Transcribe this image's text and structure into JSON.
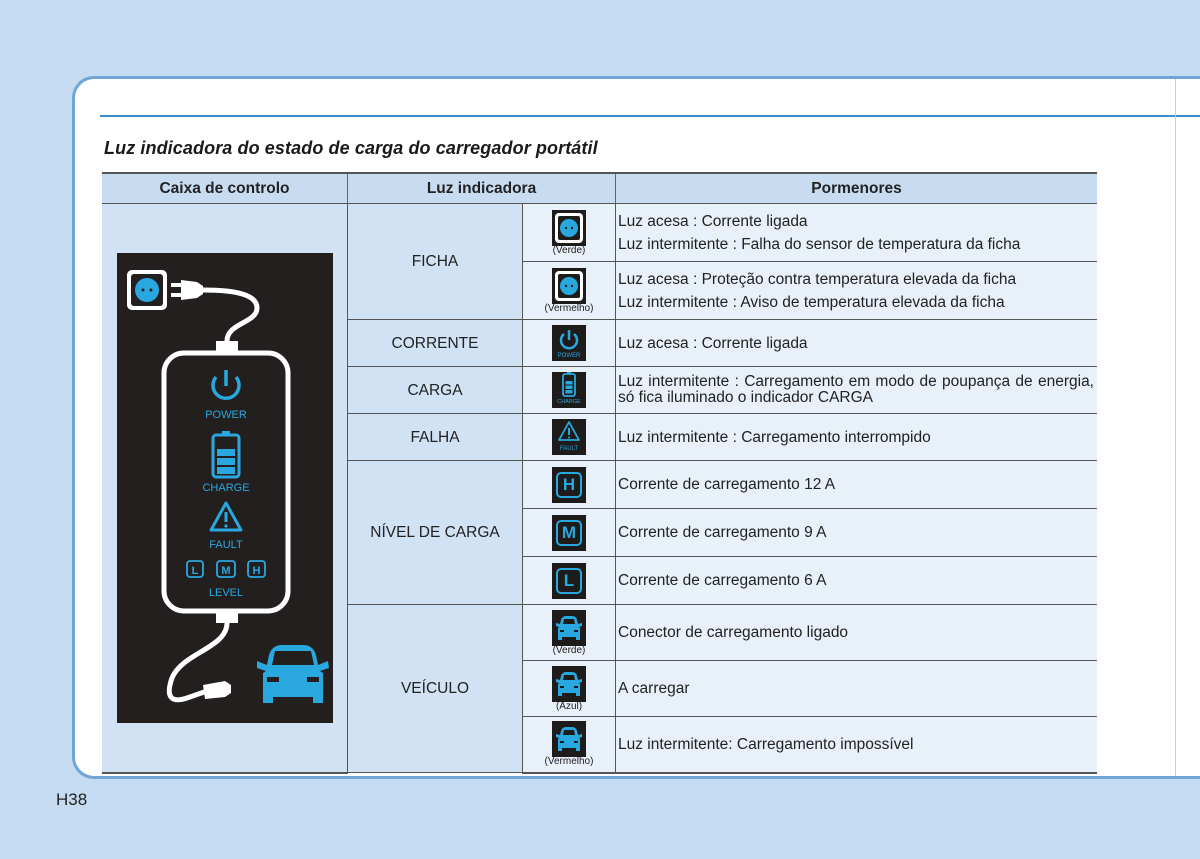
{
  "page": {
    "title": "Luz indicadora do estado de carga do carregador portátil",
    "page_number": "H38"
  },
  "colors": {
    "accent_blue": "#29a8e0",
    "panel_dark": "#231f1f",
    "header_bg": "#c8dcf1",
    "page_bg": "#c5dbf1"
  },
  "table": {
    "headers": [
      "Caixa de controlo",
      "Luz indicadora",
      "Pormenores"
    ],
    "control_box": {
      "labels": {
        "power": "POWER",
        "charge": "CHARGE",
        "fault": "FAULT",
        "level": "LEVEL",
        "level_l": "L",
        "level_m": "M",
        "level_h": "H"
      }
    },
    "groups": [
      {
        "name": "FICHA",
        "rows": [
          {
            "icon": "plug-socket-icon",
            "caption": "(Verde)",
            "details": [
              "Luz acesa : Corrente ligada",
              "Luz intermitente : Falha do sensor de temperatura da ficha"
            ]
          },
          {
            "icon": "plug-socket-icon",
            "caption": "(Vermelho)",
            "details": [
              "Luz acesa : Proteção contra temperatura elevada da ficha",
              "Luz intermitente : Aviso de temperatura elevada da ficha"
            ]
          }
        ]
      },
      {
        "name": "CORRENTE",
        "rows": [
          {
            "icon": "power-icon",
            "icon_label": "POWER",
            "details": [
              "Luz acesa : Corrente ligada"
            ]
          }
        ]
      },
      {
        "name": "CARGA",
        "rows": [
          {
            "icon": "battery-charge-icon",
            "icon_label": "CHARGE",
            "details": [
              "Luz intermitente : Carregamento em modo de poupança de energia, só fica iluminado o indicador CARGA"
            ]
          }
        ]
      },
      {
        "name": "FALHA",
        "rows": [
          {
            "icon": "fault-warning-icon",
            "icon_label": "FAULT",
            "details": [
              "Luz intermitente : Carregamento interrompido"
            ]
          }
        ]
      },
      {
        "name": "NÍVEL DE CARGA",
        "rows": [
          {
            "icon": "level-h-icon",
            "letter": "H",
            "details": [
              "Corrente de carregamento 12 A"
            ]
          },
          {
            "icon": "level-m-icon",
            "letter": "M",
            "details": [
              "Corrente de carregamento 9 A"
            ]
          },
          {
            "icon": "level-l-icon",
            "letter": "L",
            "details": [
              "Corrente de carregamento 6 A"
            ]
          }
        ]
      },
      {
        "name": "VEÍCULO",
        "rows": [
          {
            "icon": "car-icon",
            "caption": "(Verde)",
            "details": [
              "Conector de carregamento ligado"
            ]
          },
          {
            "icon": "car-icon",
            "caption": "(Azul)",
            "details": [
              "A carregar"
            ]
          },
          {
            "icon": "car-icon",
            "caption": "(Vermelho)",
            "details": [
              "Luz intermitente: Carregamento impossível"
            ]
          }
        ]
      }
    ]
  }
}
